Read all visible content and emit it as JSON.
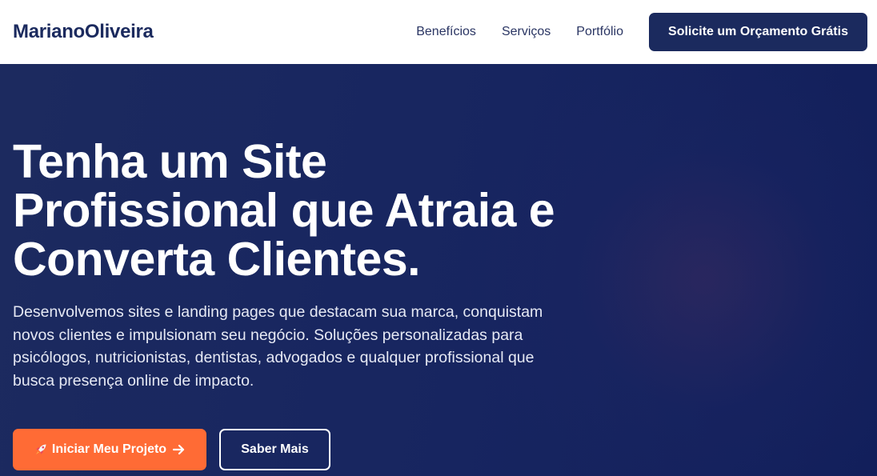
{
  "header": {
    "logo": "MarianoOliveira",
    "nav": [
      "Benefícios",
      "Serviços",
      "Portfólio"
    ],
    "cta_label": "Solicite um Orçamento Grátis"
  },
  "hero": {
    "title_lines": [
      "Tenha um Site",
      "Profissional que Atraia e",
      "Converta Clientes."
    ],
    "subtitle_lines": [
      "Desenvolvemos sites e landing pages que destacam sua marca, conquistam",
      "novos clientes e impulsionam seu negócio. Soluções personalizadas para",
      "psicólogos, nutricionistas, dentistas, advogados e qualquer profissional que",
      "busca presença online de impacto."
    ],
    "primary_button": {
      "label": "Iniciar Meu Projeto",
      "leading_icon": "rocket-icon",
      "trailing_icon": "arrow-right-icon"
    },
    "secondary_button": {
      "label": "Saber Mais"
    }
  },
  "colors": {
    "brand_navy": "#1b2a5e",
    "accent_orange": "#ff6b35",
    "hero_background": "#172560",
    "text_white": "#ffffff"
  }
}
